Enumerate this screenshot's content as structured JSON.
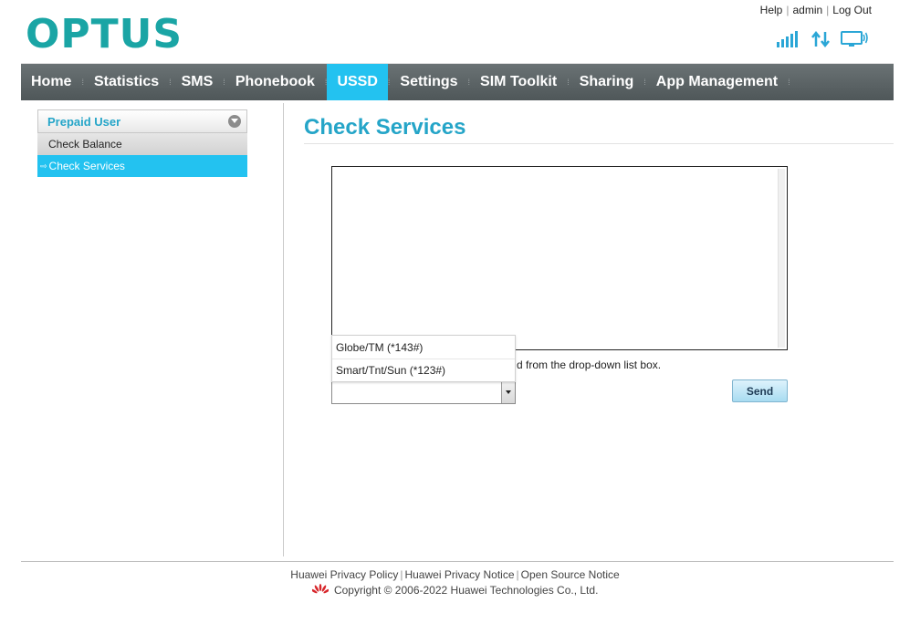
{
  "brand": {
    "logo_text": "OPTUS",
    "logo_color": "#1aa5a5"
  },
  "top_links": {
    "help": "Help",
    "user": "admin",
    "logout": "Log Out"
  },
  "status_icons": [
    "signal-strength-icon",
    "data-transfer-icon",
    "computer-connection-icon"
  ],
  "nav": {
    "items": [
      "Home",
      "Statistics",
      "SMS",
      "Phonebook",
      "USSD",
      "Settings",
      "SIM Toolkit",
      "Sharing",
      "App Management"
    ],
    "active": "USSD",
    "active_color": "#23c2f0"
  },
  "sidebar": {
    "header": "Prepaid User",
    "items": [
      {
        "label": "Check Balance",
        "active": false
      },
      {
        "label": "Check Services",
        "active": true
      }
    ]
  },
  "main": {
    "title": "Check Services",
    "response_text": "",
    "hint_partial": "d from the drop-down list box.",
    "dropdown_options": [
      "Globe/TM (*143#)",
      "Smart/Tnt/Sun (*123#)"
    ],
    "select_value": "",
    "send_label": "Send"
  },
  "footer": {
    "links": [
      "Huawei Privacy Policy",
      "Huawei Privacy Notice",
      "Open Source Notice"
    ],
    "copyright": "Copyright © 2006-2022 Huawei Technologies Co., Ltd."
  }
}
